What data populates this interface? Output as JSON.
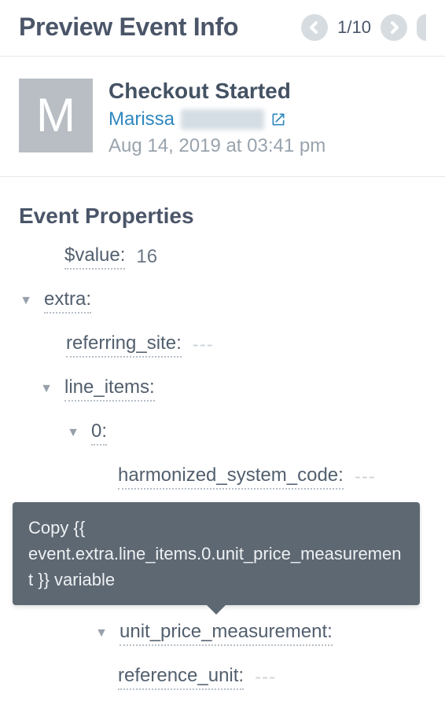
{
  "header": {
    "title": "Preview Event Info",
    "pager_text": "1/10"
  },
  "event": {
    "name": "Checkout Started",
    "user_first_name": "Marissa",
    "avatar_initial": "M",
    "timestamp": "Aug 14, 2019 at 03:41 pm"
  },
  "section_title": "Event Properties",
  "props": {
    "value_key": "$value:",
    "value_val": "16",
    "extra_key": "extra:",
    "referring_site_key": "referring_site:",
    "line_items_key": "line_items:",
    "index0_key": "0:",
    "hsc_key": "harmonized_system_code:",
    "upm_key": "unit_price_measurement:",
    "ref_unit_key": "reference_unit:",
    "empty": "---"
  },
  "tooltip": {
    "text": "Copy {{ event.extra.line_items.0.unit_price_measurement }} variable"
  }
}
